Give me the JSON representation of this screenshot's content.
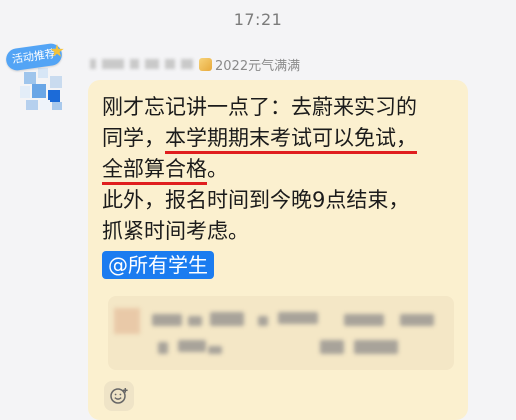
{
  "status": {
    "time": "17:21"
  },
  "sender": {
    "badge": "活动推荐",
    "title_badge": "2022元气满满"
  },
  "message": {
    "line1": "刚才忘记讲一点了：去蔚来实习的",
    "line2_a": "同学，",
    "line2_b": "本学期期末考试可以免试，",
    "line3_a": "全部算合格",
    "line3_b": "。",
    "line4": "此外，报名时间到今晚9点结束，",
    "line5": "抓紧时间考虑。",
    "mention": "@所有学生"
  },
  "reaction": {
    "icon": "emoji-add-icon"
  },
  "colors": {
    "bubble": "#fbf0cf",
    "mention_bg": "#1b7cf0",
    "underline": "#e01e1e"
  }
}
